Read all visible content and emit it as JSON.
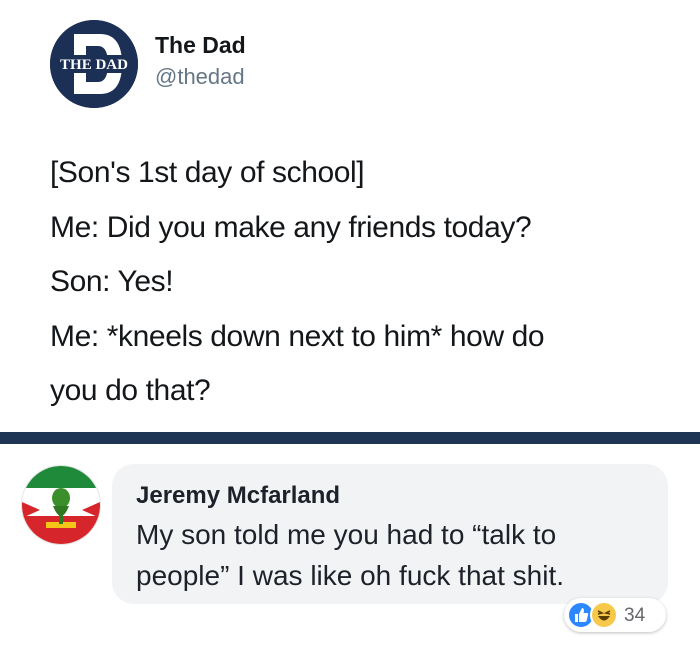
{
  "tweet": {
    "display_name": "The Dad",
    "handle": "@thedad",
    "avatar": {
      "icon": "the-dad-logo-icon",
      "logo_text": "THE DAD",
      "color": "#1c2f55"
    },
    "lines": [
      "[Son's 1st day of school]",
      "Me: Did you make any friends today?",
      "Son: Yes!",
      "Me: *kneels down next to him* how do",
      "you do that?"
    ]
  },
  "divider": {
    "color": "#1e3554"
  },
  "comment": {
    "author": "Jeremy Mcfarland",
    "text": "My son told me you had to “talk to people” I was like oh fuck that shit.",
    "avatar": {
      "icon": "profile-avatar-icon"
    },
    "reactions": {
      "icons": [
        "like-reaction-icon",
        "haha-reaction-icon"
      ],
      "count": "34"
    },
    "bubble_color": "#f2f3f5"
  }
}
